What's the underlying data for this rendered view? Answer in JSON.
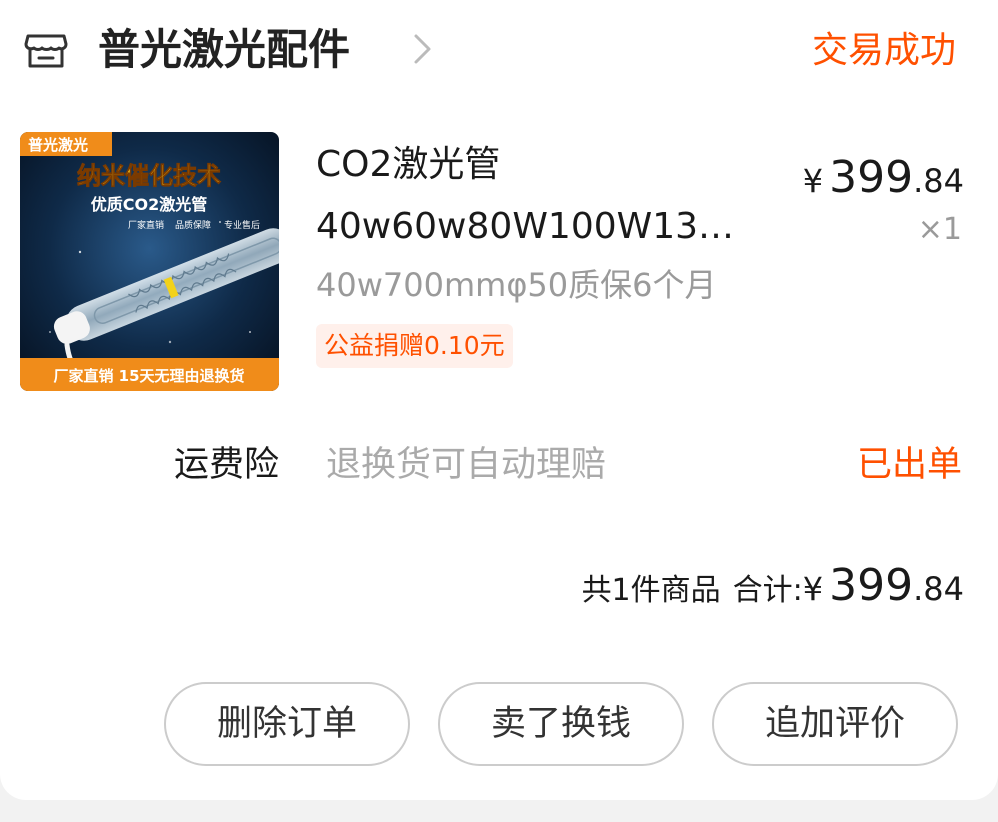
{
  "shop": {
    "name": "普光激光配件",
    "status": "交易成功"
  },
  "product": {
    "title_line1": "CO2激光管",
    "title_line2": "40w60w80W100W13…",
    "sku": "40w700mmφ50质保6个月",
    "charity_badge": "公益捐赠0.10元",
    "price_symbol": "¥",
    "price_integer": "399",
    "price_decimal": ".84",
    "quantity": "×1",
    "thumbnail": {
      "brand_tag": "普光激光",
      "headline": "纳米催化技术",
      "subhead": "优质CO2激光管",
      "features": [
        "厂家直销",
        "品质保障",
        "专业售后"
      ],
      "footer": "厂家直销 15天无理由退换货"
    }
  },
  "insurance": {
    "label": "运费险",
    "description": "退换货可自动理赔",
    "status": "已出单"
  },
  "summary": {
    "count_text": "共1件商品",
    "total_label": "合计:",
    "price_symbol": "¥",
    "price_integer": "399",
    "price_decimal": ".84"
  },
  "actions": {
    "delete_label": "删除订单",
    "sell_label": "卖了换钱",
    "review_label": "追加评价"
  },
  "colors": {
    "accent": "#ff5000",
    "text_primary": "#1a1a1a",
    "text_secondary": "#9a9a9a",
    "background": "#f2f2f2",
    "card": "#ffffff"
  },
  "icons": {
    "shop": "store-icon",
    "chevron": "chevron-right-icon"
  }
}
